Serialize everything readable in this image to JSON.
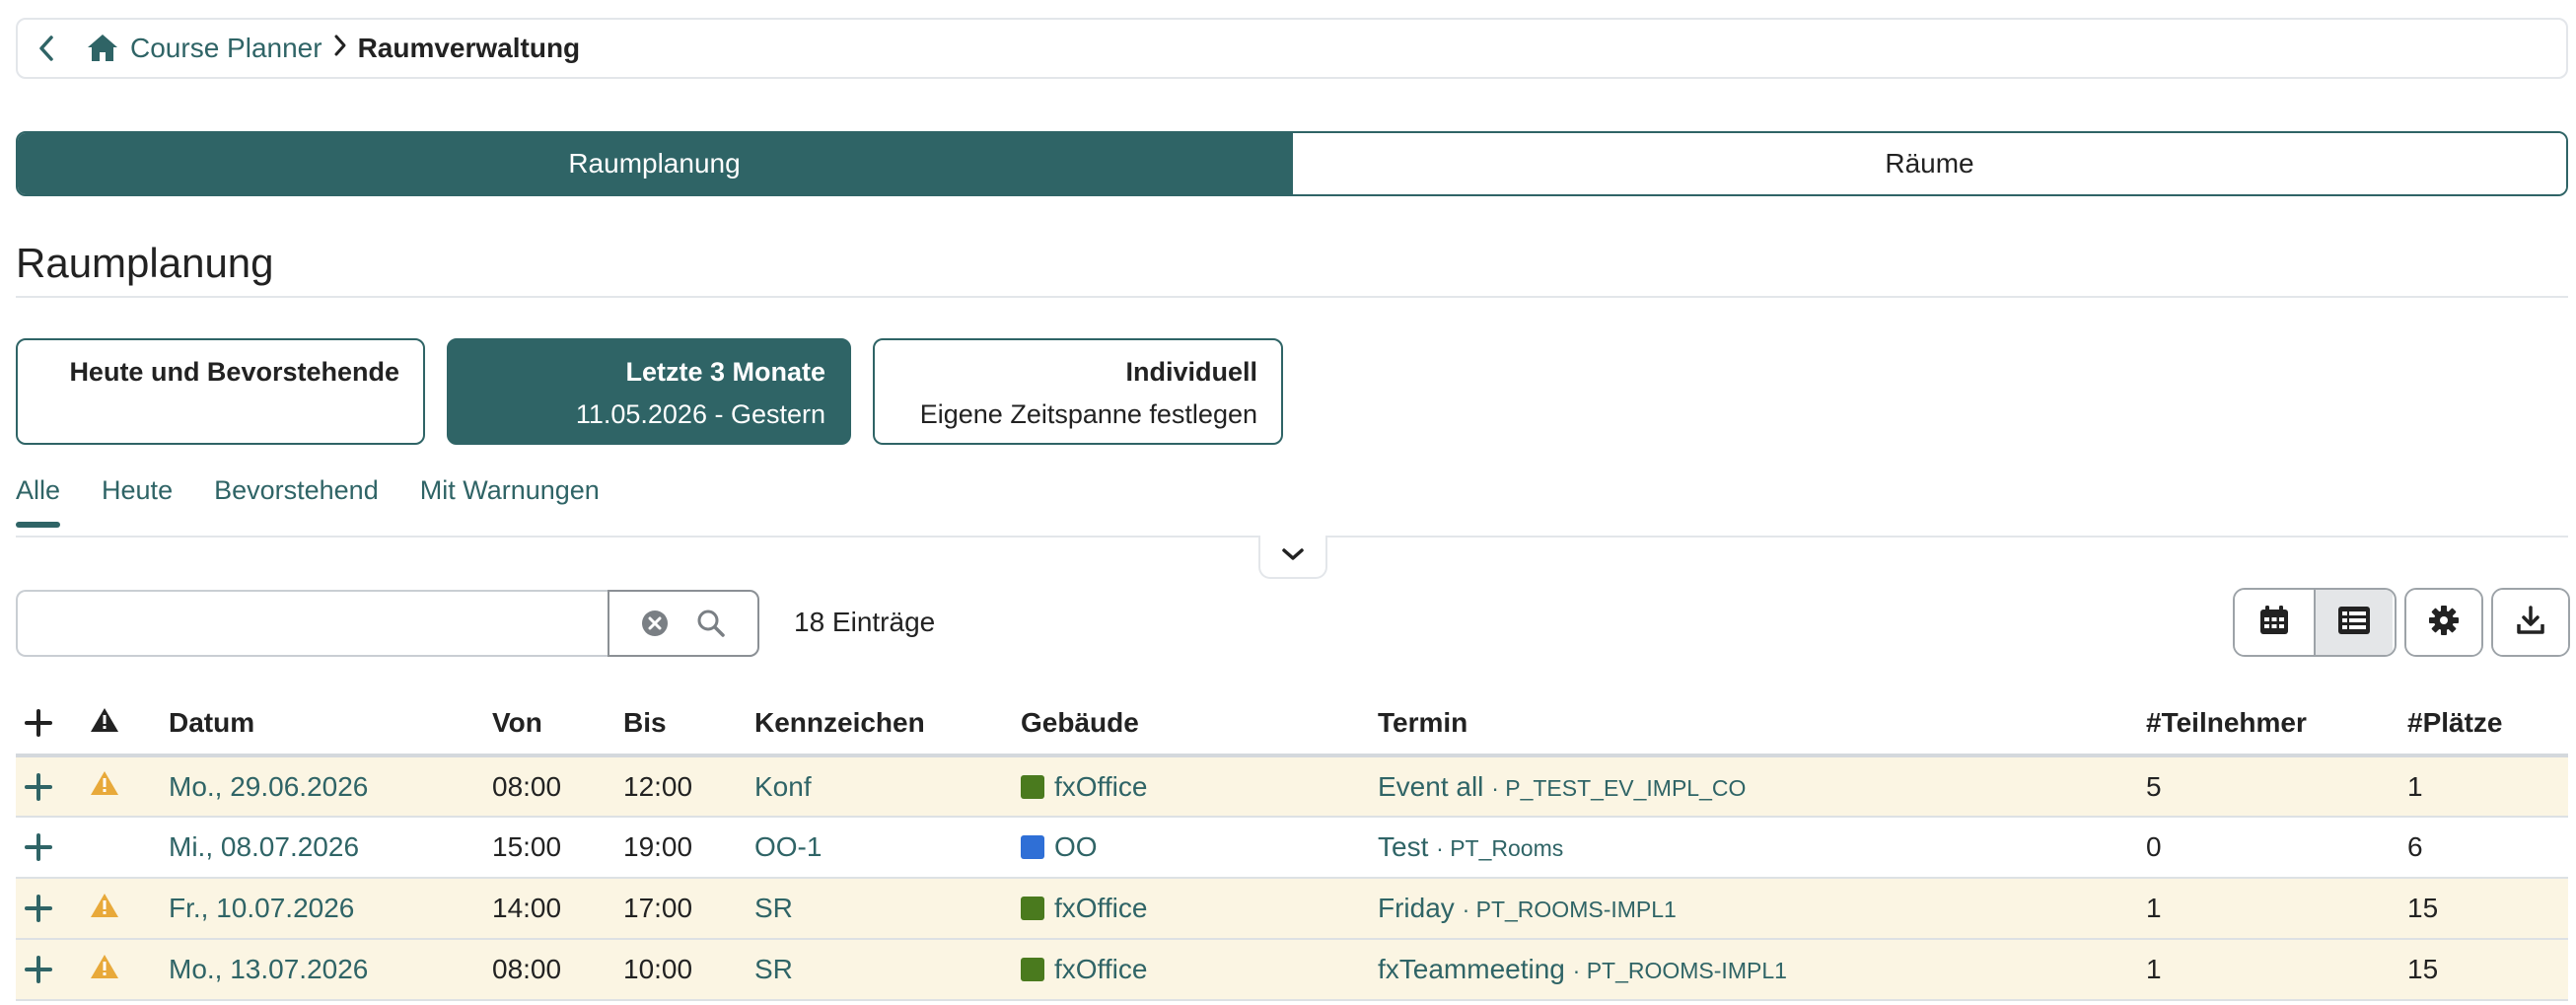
{
  "breadcrumb": {
    "home_label": "Course Planner",
    "separator": ">",
    "current": "Raumverwaltung"
  },
  "segments": [
    {
      "label": "Raumplanung",
      "active": true
    },
    {
      "label": "Räume",
      "active": false
    }
  ],
  "page_title": "Raumplanung",
  "cards": [
    {
      "title": "Heute und Bevorstehende",
      "subtitle": ""
    },
    {
      "title": "Letzte 3 Monate",
      "subtitle": "11.05.2026 - Gestern"
    },
    {
      "title": "Individuell",
      "subtitle": "Eigene Zeitspanne festlegen"
    }
  ],
  "tabs": [
    "Alle",
    "Heute",
    "Bevorstehend",
    "Mit Warnungen"
  ],
  "search": {
    "value": "",
    "placeholder": ""
  },
  "entry_count": "18 Einträge",
  "table": {
    "headers": [
      "Datum",
      "Von",
      "Bis",
      "Kennzeichen",
      "Gebäude",
      "Termin",
      "#Teilnehmer",
      "#Plätze"
    ],
    "rows": [
      {
        "date": "Mo., 29.06.2026",
        "from": "08:00",
        "to": "12:00",
        "code": "Konf",
        "building": "fxOffice",
        "building_color": "#4a7a1e",
        "event": "Event all",
        "event_code": "· P_TEST_EV_IMPL_CO",
        "participants": "5",
        "seats": "1",
        "warning": true
      },
      {
        "date": "Mi., 08.07.2026",
        "from": "15:00",
        "to": "19:00",
        "code": "OO-1",
        "building": "OO",
        "building_color": "#2f6fd6",
        "event": "Test",
        "event_code": "· PT_Rooms",
        "participants": "0",
        "seats": "6",
        "warning": false
      },
      {
        "date": "Fr., 10.07.2026",
        "from": "14:00",
        "to": "17:00",
        "code": "SR",
        "building": "fxOffice",
        "building_color": "#4a7a1e",
        "event": "Friday",
        "event_code": "· PT_ROOMS-IMPL1",
        "participants": "1",
        "seats": "15",
        "warning": true
      },
      {
        "date": "Mo., 13.07.2026",
        "from": "08:00",
        "to": "10:00",
        "code": "SR",
        "building": "fxOffice",
        "building_color": "#4a7a1e",
        "event": "fxTeammeeting",
        "event_code": "· PT_ROOMS-IMPL1",
        "participants": "1",
        "seats": "15",
        "warning": true
      }
    ]
  },
  "colors": {
    "accent": "#2f6466",
    "warning_row": "#fbf5e3",
    "warning_icon": "#e8a93a"
  },
  "icons": [
    "back-icon",
    "home-icon",
    "chevron-down-icon",
    "clear-icon",
    "search-icon",
    "calendar-icon",
    "list-icon",
    "gear-icon",
    "download-icon",
    "plus-icon",
    "warning-icon"
  ]
}
